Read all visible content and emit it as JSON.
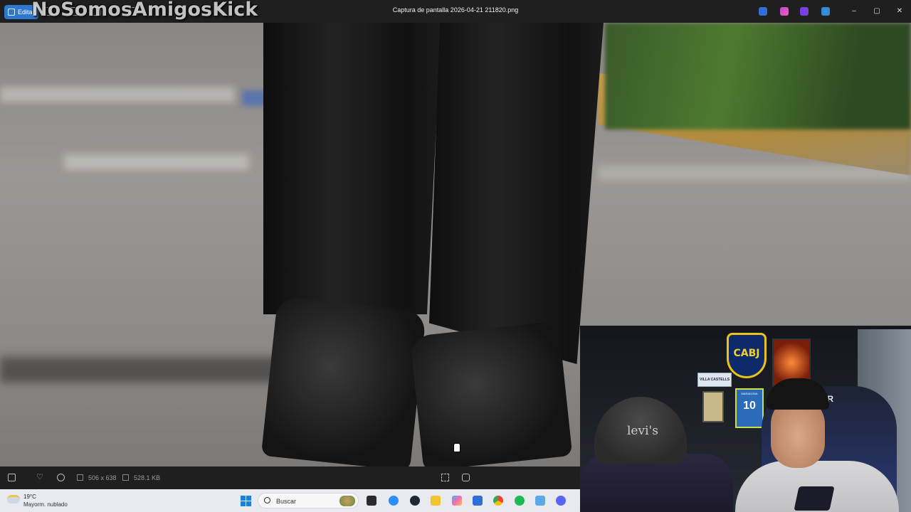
{
  "titlebar": {
    "edit_label": "Editar",
    "window_title": "Captura de pantalla 2026-04-21 211820.png",
    "watermark": "NoSomosAmigosKick",
    "controls": {
      "minimize": "–",
      "maximize": "▢",
      "close": "✕"
    }
  },
  "viewer": {
    "image_dimensions": "506 x 638",
    "file_size": "528.1 KB"
  },
  "taskbar": {
    "weather_temp": "19°C",
    "weather_condition": "Mayorm. nublado",
    "search_placeholder": "Buscar",
    "apps": [
      "file-explorer",
      "zoom",
      "steam",
      "folder",
      "copilot",
      "store",
      "chrome",
      "spotify",
      "photos",
      "discord"
    ],
    "colors": {
      "accent": "#1c7fd8",
      "edit_button": "#2e78d2"
    }
  },
  "webcam": {
    "badge_text": "CABJ",
    "plate_text": "VILLA CASTELLS",
    "shirt_name": "MARADONA",
    "shirt_number": "10",
    "cap_text": "levi's",
    "chair_text": "DAR"
  }
}
